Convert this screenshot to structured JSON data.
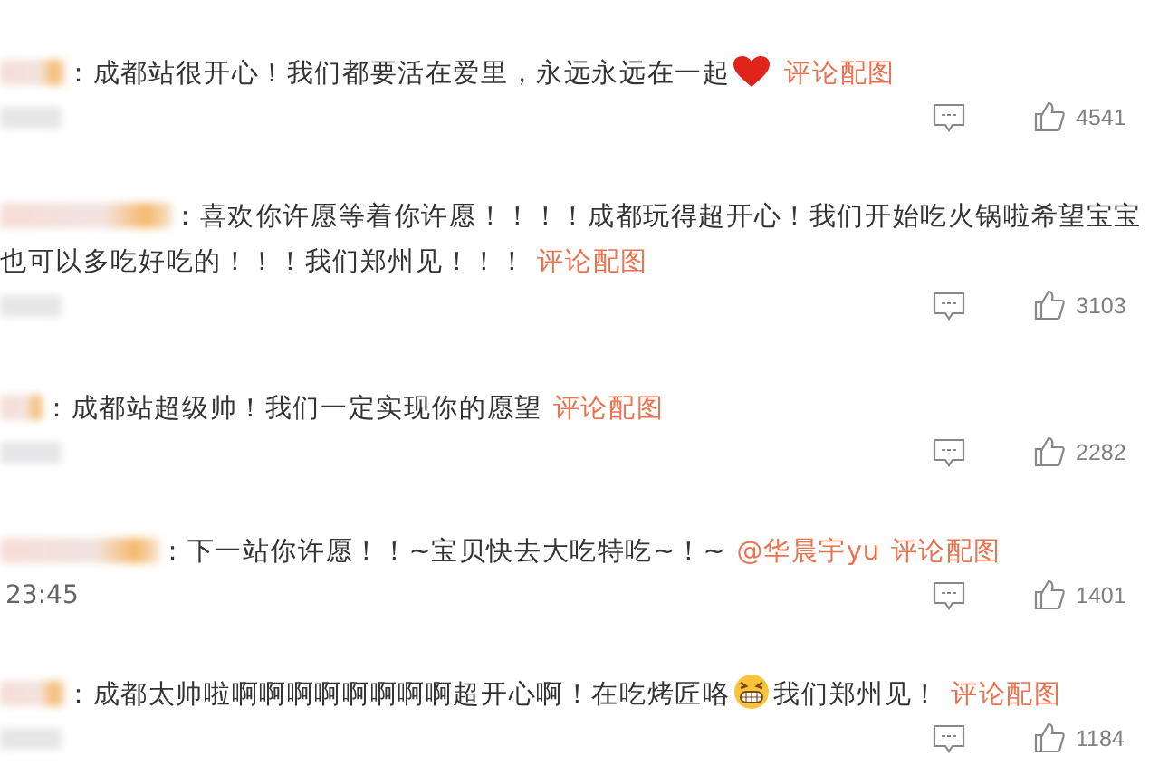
{
  "comments": [
    {
      "lines": [
        [
          {
            "kind": "text",
            "text": "：成都站很开心！我们都要活在爱里，永远永远在一起"
          },
          {
            "kind": "heart"
          },
          {
            "kind": "link",
            "text": "评论配图"
          }
        ]
      ],
      "likes": "4541"
    },
    {
      "lines": [
        [
          {
            "kind": "text",
            "text": "：喜欢你许愿等着你许愿！！！！成都玩得超开心！我们开始吃火锅啦希望宝宝"
          }
        ],
        [
          {
            "kind": "text",
            "text": "也可以多吃好吃的！！！我们郑州见！！！"
          },
          {
            "kind": "link",
            "text": "评论配图"
          }
        ]
      ],
      "likes": "3103"
    },
    {
      "lines": [
        [
          {
            "kind": "text",
            "text": "：成都站超级帅！我们一定实现你的愿望"
          },
          {
            "kind": "link",
            "text": "评论配图"
          }
        ]
      ],
      "likes": "2282"
    },
    {
      "lines": [
        [
          {
            "kind": "text",
            "text": "：下一站你许愿！！~宝贝快去大吃特吃~！~"
          },
          {
            "kind": "link",
            "text": "@华晨宇yu"
          },
          {
            "kind": "link",
            "text": "评论配图"
          }
        ]
      ],
      "time": "23:45",
      "likes": "1401"
    },
    {
      "lines": [
        [
          {
            "kind": "text",
            "text": "：成都太帅啦啊啊啊啊啊啊啊啊超开心啊！在吃烤匠咯"
          },
          {
            "kind": "grin"
          },
          {
            "kind": "text",
            "text": "我们郑州见！"
          },
          {
            "kind": "link",
            "text": "评论配图"
          }
        ]
      ],
      "likes": "1184"
    }
  ]
}
